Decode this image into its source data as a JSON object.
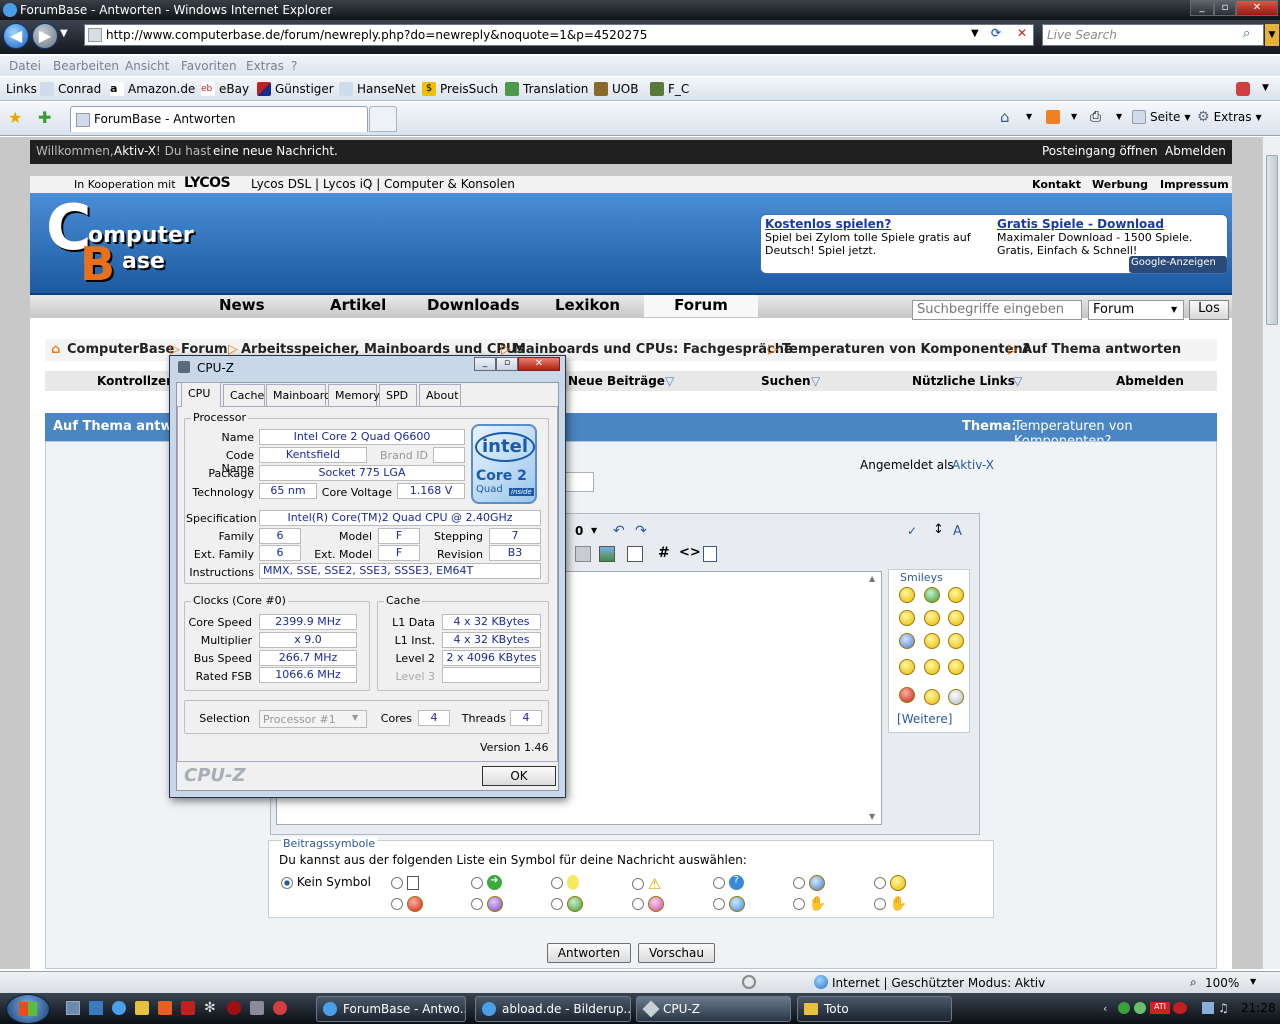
{
  "window": {
    "title": "ForumBase - Antworten - Windows Internet Explorer"
  },
  "address": {
    "url": "http://www.computerbase.de/forum/newreply.php?do=newreply&noquote=1&p=4520275",
    "search_placeholder": "Live Search"
  },
  "menu": [
    "Datei",
    "Bearbeiten",
    "Ansicht",
    "Favoriten",
    "Extras",
    "?"
  ],
  "links": {
    "label": "Links",
    "items": [
      "Conrad",
      "Amazon.de",
      "eBay",
      "Günstiger",
      "HanseNet",
      "PreisSuch",
      "Translation",
      "UOB",
      "F_C"
    ]
  },
  "tab": {
    "title": "ForumBase - Antworten"
  },
  "toolbar_right": {
    "page": "Seite",
    "tools": "Extras"
  },
  "site": {
    "welcome_pre": "Willkommen,",
    "welcome_user": "Aktiv-X",
    "welcome_mid": "! Du hast",
    "welcome_msg": "eine neue Nachricht.",
    "inbox": "Posteingang öffnen",
    "logout": "Abmelden",
    "coop_pre": "In Kooperation mit",
    "coop_brand": "LYCOS",
    "coop_links": "Lycos DSL  |  Lycos iQ  |  Computer & Konsolen",
    "top_links": [
      "Kontakt",
      "Werbung",
      "Impressum"
    ],
    "logo_top": "omputer",
    "logo_bottom": "ase",
    "ads": [
      {
        "title": "Kostenlos spielen?",
        "text": "Spiel bei Zylom tolle Spiele gratis auf Deutsch! Spiel jetzt."
      },
      {
        "title": "Gratis Spiele - Download",
        "text": "Maximaler Download - 1500 Spiele. Gratis, Einfach & Schnell!"
      }
    ],
    "google_ads": "Google-Anzeigen",
    "nav": [
      "News",
      "Artikel",
      "Downloads",
      "Lexikon",
      "Forum"
    ],
    "search_placeholder": "Suchbegriffe eingeben",
    "search_scope": "Forum",
    "search_btn": "Los",
    "crumbs": [
      "ComputerBase",
      "Forum",
      "Arbeitsspeicher, Mainboards und CPUs",
      "Mainboards und CPUs: Fachgespräche",
      "Temperaturen von Komponenten?",
      "Auf Thema antworten"
    ],
    "subnav": [
      "Kontrollzentrum",
      "Neue Beiträge",
      "Suchen",
      "Nützliche Links",
      "Abmelden"
    ],
    "panel_title": "Auf Thema antworten",
    "thread_label": "Thema:",
    "thread_title": "Temperaturen von Komponenten?",
    "logged_in": "Angemeldet als",
    "logged_user": "Aktiv-X",
    "smileys_label": "Smileys",
    "smileys_more": "Weitere",
    "symbols_label": "Beitragssymbole",
    "symbols_text": "Du kannst aus der folgenden Liste ein Symbol für deine Nachricht auswählen:",
    "no_symbol": "Kein Symbol",
    "submit": "Antworten",
    "preview": "Vorschau"
  },
  "status": {
    "zone": "Internet | Geschützter Modus: Aktiv",
    "zoom": "100%"
  },
  "taskbar": {
    "buttons": [
      "ForumBase - Antwo...",
      "abload.de - Bilderup...",
      "CPU-Z",
      "Toto"
    ],
    "clock": "21:28"
  },
  "cpuz": {
    "title": "CPU-Z",
    "tabs": [
      "CPU",
      "Cache",
      "Mainboard",
      "Memory",
      "SPD",
      "About"
    ],
    "processor_label": "Processor",
    "name_label": "Name",
    "name": "Intel Core 2 Quad Q6600",
    "codename_label": "Code Name",
    "codename": "Kentsfield",
    "brandid_label": "Brand ID",
    "package_label": "Package",
    "package": "Socket 775 LGA",
    "technology_label": "Technology",
    "technology": "65 nm",
    "voltage_label": "Core Voltage",
    "voltage": "1.168 V",
    "spec_label": "Specification",
    "spec": "Intel(R) Core(TM)2 Quad CPU          @ 2.40GHz",
    "family_label": "Family",
    "family": "6",
    "model_label": "Model",
    "model": "F",
    "stepping_label": "Stepping",
    "stepping": "7",
    "extfamily_label": "Ext. Family",
    "extfamily": "6",
    "extmodel_label": "Ext. Model",
    "extmodel": "F",
    "revision_label": "Revision",
    "revision": "B3",
    "instructions_label": "Instructions",
    "instructions": "MMX, SSE, SSE2, SSE3, SSSE3, EM64T",
    "clocks_label": "Clocks (Core #0)",
    "corespeed_label": "Core Speed",
    "corespeed": "2399.9 MHz",
    "multiplier_label": "Multiplier",
    "multiplier": "x 9.0",
    "busspeed_label": "Bus Speed",
    "busspeed": "266.7 MHz",
    "fsb_label": "Rated FSB",
    "fsb": "1066.6 MHz",
    "cache_label": "Cache",
    "l1d_label": "L1 Data",
    "l1d": "4 x 32 KBytes",
    "l1i_label": "L1 Inst.",
    "l1i": "4 x 32 KBytes",
    "l2_label": "Level 2",
    "l2": "2 x 4096 KBytes",
    "l3_label": "Level 3",
    "selection_label": "Selection",
    "selection": "Processor #1",
    "cores_label": "Cores",
    "cores": "4",
    "threads_label": "Threads",
    "threads": "4",
    "version": "Version 1.46",
    "brand": "CPU-Z",
    "ok": "OK",
    "intel_logo": "intel",
    "intel_product": "Core 2",
    "intel_sub": "Quad",
    "intel_inside": "inside"
  }
}
